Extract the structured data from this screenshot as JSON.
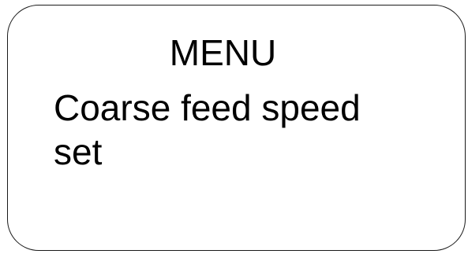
{
  "display": {
    "title": "MENU",
    "item_line_1": "Coarse feed speed",
    "item_line_2": "set"
  }
}
